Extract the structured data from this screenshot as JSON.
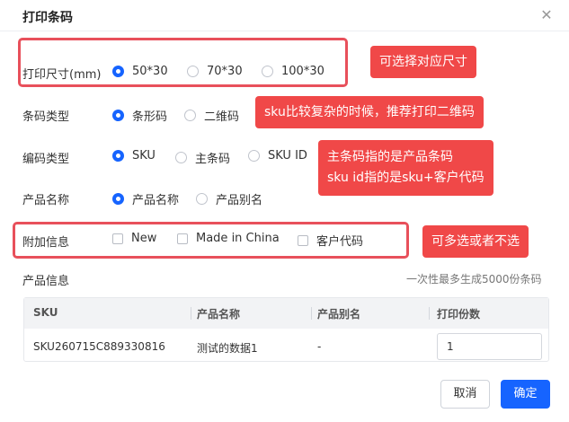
{
  "dialog": {
    "title": "打印条码"
  },
  "print_size": {
    "label": "打印尺寸(mm)",
    "options": [
      "50*30",
      "70*30",
      "100*30"
    ],
    "selected": "50*30"
  },
  "barcode_type": {
    "label": "条码类型",
    "options": [
      "条形码",
      "二维码"
    ],
    "selected": "条形码"
  },
  "code_type": {
    "label": "编码类型",
    "options": [
      "SKU",
      "主条码",
      "SKU ID"
    ],
    "selected": "SKU"
  },
  "product_name": {
    "label": "产品名称",
    "options": [
      "产品名称",
      "产品别名"
    ],
    "selected": "产品名称"
  },
  "extra_info": {
    "label": "附加信息",
    "options": [
      "New",
      "Made in China",
      "客户代码"
    ]
  },
  "callouts": {
    "size": "可选择对应尺寸",
    "barcode": "sku比较复杂的时候，推荐打印二维码",
    "code_line1": "主条码指的是产品条码",
    "code_line2": "sku id指的是sku+客户代码",
    "extra": "可多选或者不选"
  },
  "product_info": {
    "title": "产品信息",
    "hint": "一次性最多生成5000份条码",
    "columns": [
      "SKU",
      "产品名称",
      "产品别名",
      "打印份数"
    ],
    "rows": [
      {
        "sku": "SKU260715C889330816",
        "name": "测试的数据1",
        "alias": "-",
        "copies": "1"
      }
    ]
  },
  "buttons": {
    "cancel": "取消",
    "ok": "确定"
  },
  "colors": {
    "accent": "#1664ff",
    "annotation": "#f04848"
  }
}
